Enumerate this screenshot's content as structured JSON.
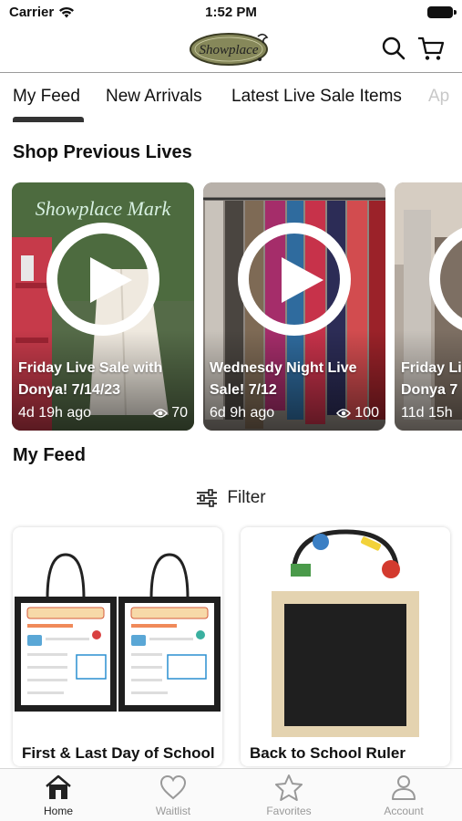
{
  "status_bar": {
    "carrier": "Carrier",
    "time": "1:52 PM"
  },
  "header": {
    "logo_text": "Showplace"
  },
  "tabs": [
    {
      "label": "My Feed"
    },
    {
      "label": "New Arrivals"
    },
    {
      "label": "Latest Live Sale Items"
    },
    {
      "label": "Ap"
    }
  ],
  "shop_previous_lives": {
    "title": "Shop Previous Lives",
    "cards": [
      {
        "title": "Friday Live Sale with Donya! 7/14/23",
        "age": "4d 19h ago",
        "views": "70"
      },
      {
        "title": "Wednesdy Night Live Sale! 7/12",
        "age": "6d 9h ago",
        "views": "100"
      },
      {
        "title": "Friday Li Donya 7",
        "age": "11d 15h",
        "views": ""
      }
    ]
  },
  "my_feed": {
    "title": "My Feed",
    "filter_label": "Filter",
    "products": [
      {
        "name": "First & Last Day of School"
      },
      {
        "name": "Back to School Ruler"
      }
    ]
  },
  "tab_bar": [
    {
      "label": "Home",
      "icon": "home-icon",
      "active": true
    },
    {
      "label": "Waitlist",
      "icon": "heart-icon",
      "active": false
    },
    {
      "label": "Favorites",
      "icon": "star-icon",
      "active": false
    },
    {
      "label": "Account",
      "icon": "person-icon",
      "active": false
    }
  ]
}
